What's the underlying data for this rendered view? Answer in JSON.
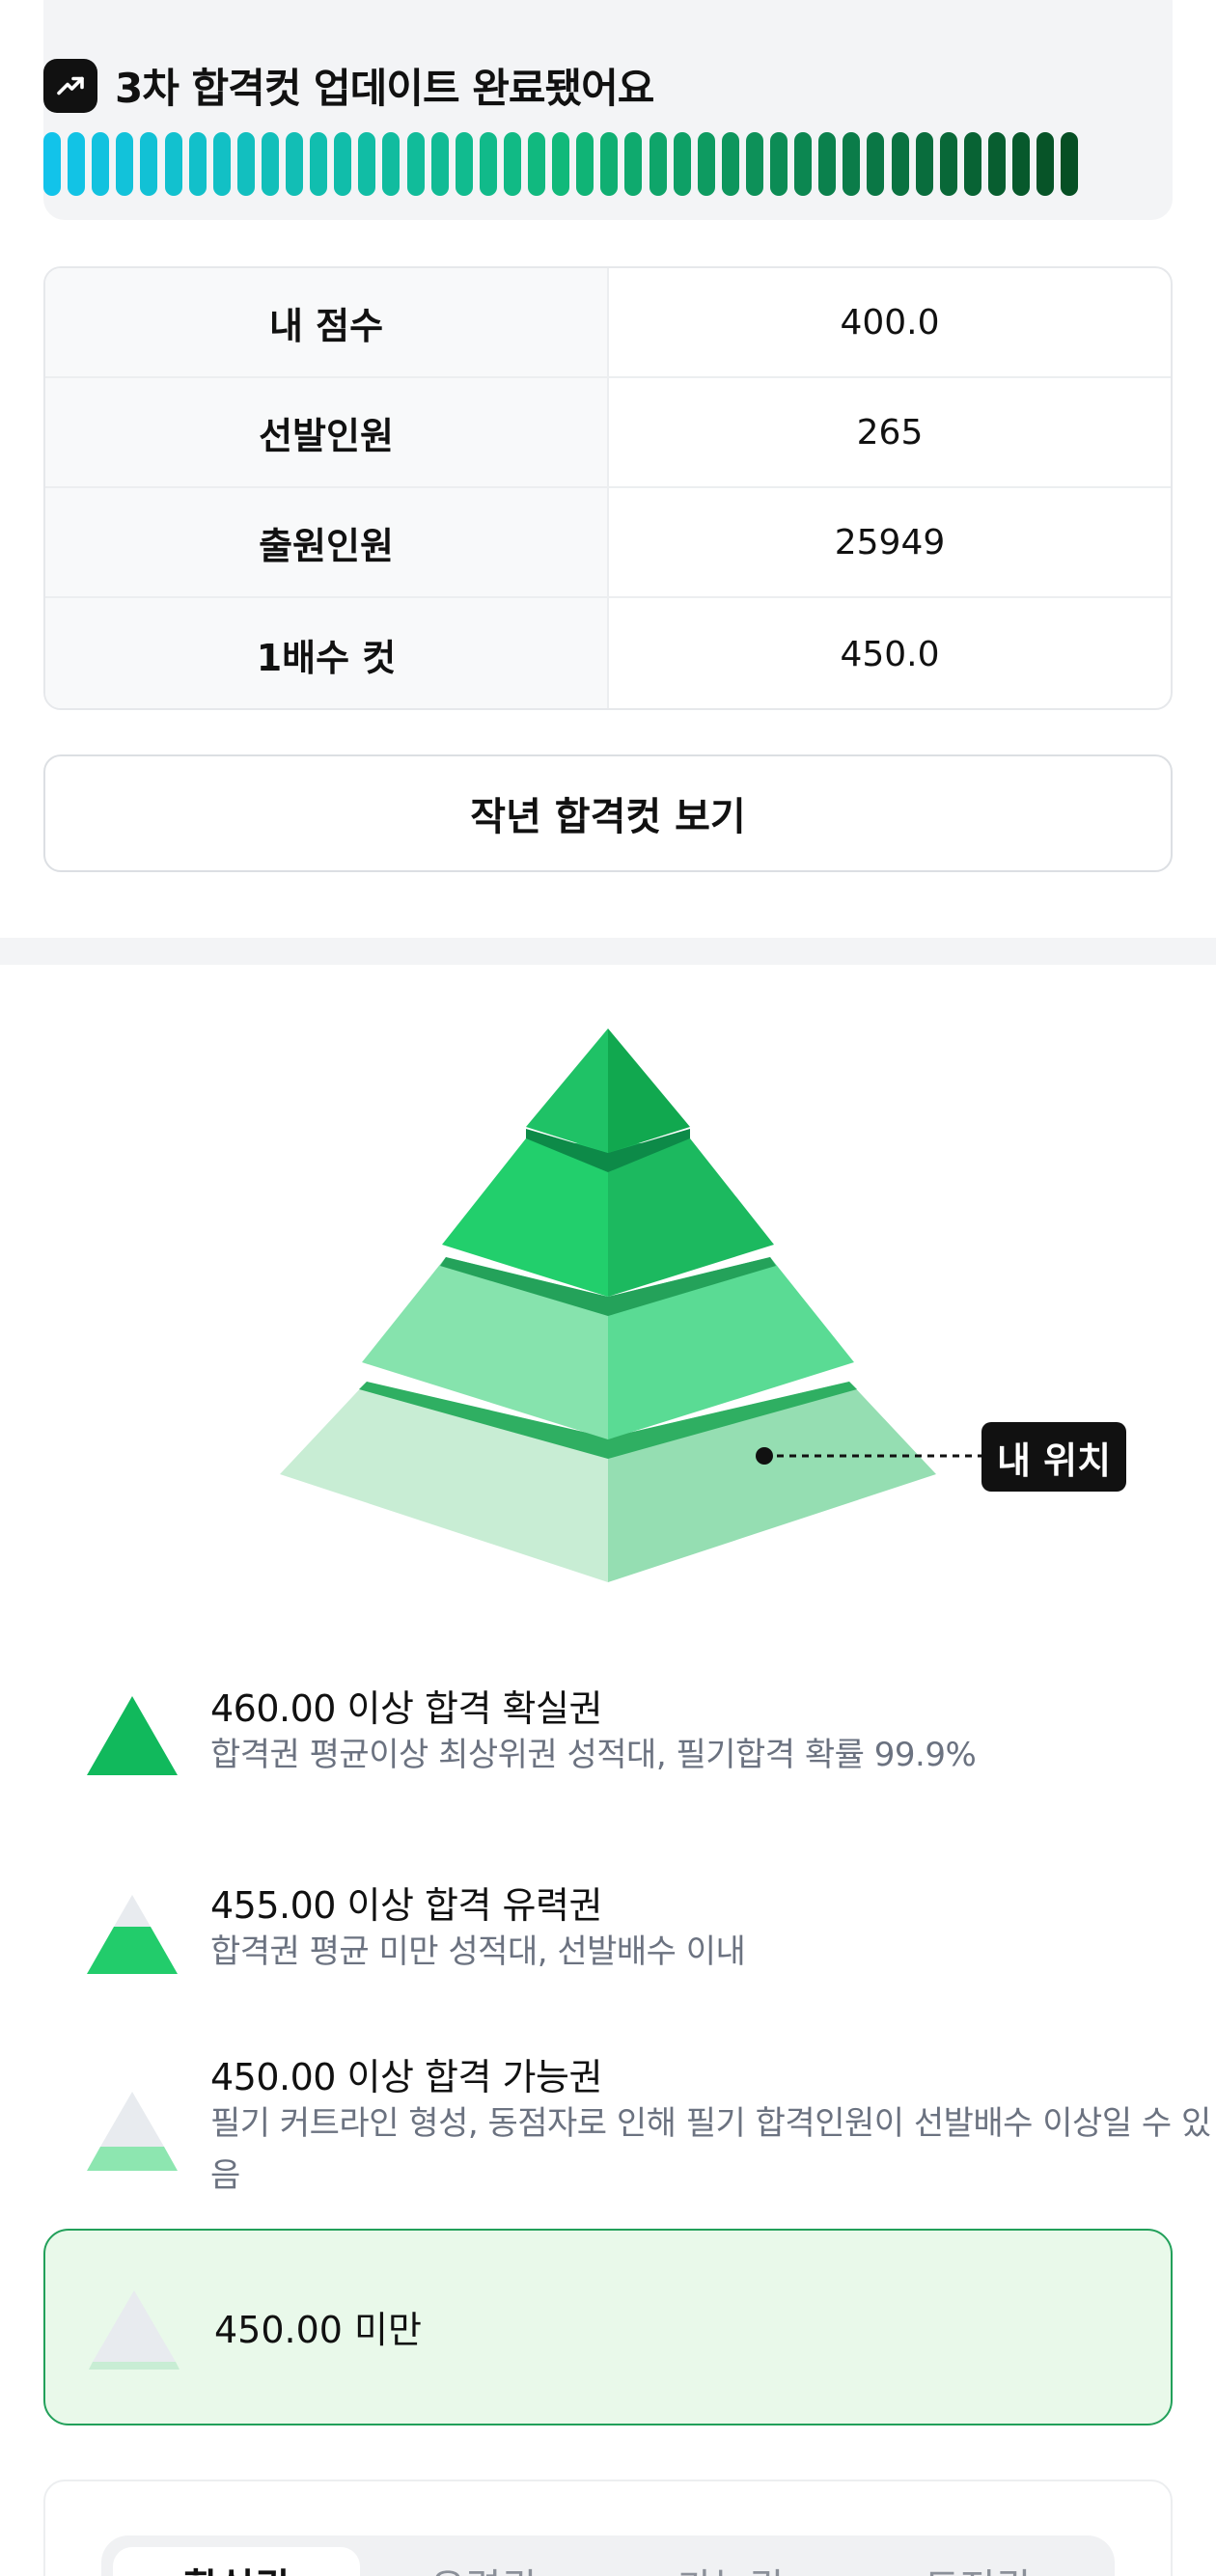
{
  "update": {
    "title": "3차 합격컷 업데이트 완료됐어요",
    "icon": "trending-up-icon",
    "progress_colors": [
      "#12c3ea",
      "#11b97a",
      "#064f24"
    ]
  },
  "score_table": [
    {
      "label": "내 점수",
      "value": "400.0"
    },
    {
      "label": "선발인원",
      "value": "265"
    },
    {
      "label": "출원인원",
      "value": "25949"
    },
    {
      "label": "1배수 컷",
      "value": "450.0"
    }
  ],
  "prev_year_button": "작년 합격컷 보기",
  "pyramid": {
    "my_position_label": "내 위치"
  },
  "legend": [
    {
      "title": "460.00 이상 합격 확실권",
      "desc": "합격권 평균이상 최상위권 성적대, 필기합격 확률 99.9%"
    },
    {
      "title": "455.00 이상 합격 유력권",
      "desc": "합격권 평균 미만 성적대, 선발배수 이내"
    },
    {
      "title": "450.00 이상 합격 가능권",
      "desc": "필기 커트라인 형성, 동점자로 인해 필기 합격인원이 선발배수 이상일 수 있음"
    },
    {
      "title": "450.00 미만",
      "desc": ""
    }
  ],
  "tabs": [
    "확실권",
    "유력권",
    "가능권",
    "도전권"
  ],
  "colors": {
    "accent": "#22a05a",
    "highlight_bg": "#e9f9ea"
  }
}
